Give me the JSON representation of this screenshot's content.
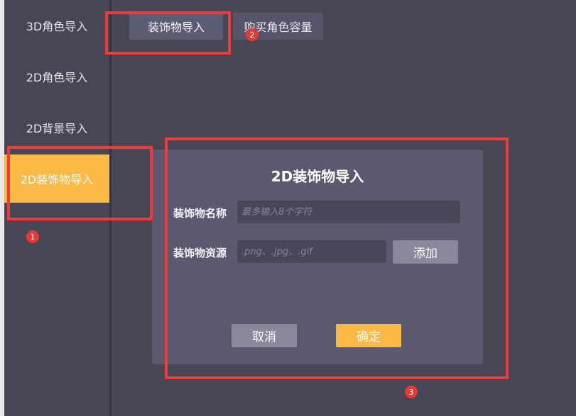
{
  "sidebar": {
    "items": [
      {
        "label": "3D角色导入"
      },
      {
        "label": "2D角色导入"
      },
      {
        "label": "2D背景导入"
      },
      {
        "label": "2D装饰物导入"
      }
    ]
  },
  "topbar": {
    "tabs": [
      {
        "label": "装饰物导入"
      },
      {
        "label": "购买角色容量"
      }
    ]
  },
  "dialog": {
    "title": "2D装饰物导入",
    "name_label": "装饰物名称",
    "name_placeholder": "最多输入8个字符",
    "resource_label": "装饰物资源",
    "resource_placeholder": ".png、.jpg、.gif",
    "add_label": "添加",
    "cancel_label": "取消",
    "confirm_label": "确定"
  },
  "annotations": {
    "badge1": "1",
    "badge2": "2",
    "badge3": "3"
  },
  "colors": {
    "accent": "#fbb945",
    "background": "#474654",
    "dialog": "#5a5970",
    "highlight": "#ee3b3b"
  }
}
